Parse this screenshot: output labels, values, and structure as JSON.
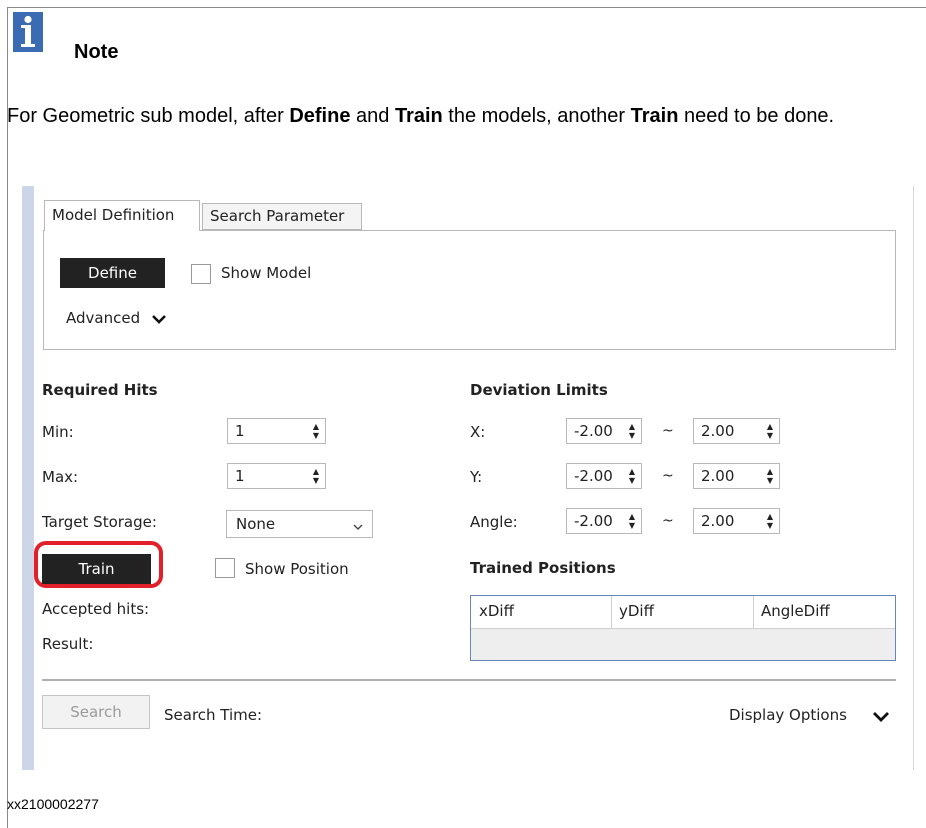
{
  "note": {
    "icon": "info-icon",
    "title": "Note",
    "text_parts": [
      {
        "text": "For Geometric sub model, after ",
        "bold": false
      },
      {
        "text": "Define",
        "bold": true
      },
      {
        "text": " and ",
        "bold": false
      },
      {
        "text": "Train",
        "bold": true
      },
      {
        "text": " the models, another ",
        "bold": false
      },
      {
        "text": "Train",
        "bold": true
      },
      {
        "text": " need to be done.",
        "bold": false
      }
    ]
  },
  "screenshot": {
    "tabs": [
      "Model Definition",
      "Search Parameter"
    ],
    "define_label": "Define",
    "show_model_label": "Show Model",
    "advanced_label": "Advanced",
    "required_hits": {
      "heading": "Required Hits",
      "min_label": "Min:",
      "min_value": "1",
      "max_label": "Max:",
      "max_value": "1",
      "target_label": "Target Storage:",
      "target_value": "None"
    },
    "deviation": {
      "heading": "Deviation Limits",
      "x_label": "X:",
      "x_min": "-2.00",
      "x_max": "2.00",
      "y_label": "Y:",
      "y_min": "-2.00",
      "y_max": "2.00",
      "angle_label": "Angle:",
      "angle_min": "-2.00",
      "angle_max": "2.00",
      "separator": "~"
    },
    "train_label": "Train",
    "show_position_label": "Show Position",
    "accepted_hits_label": "Accepted hits:",
    "result_label": "Result:",
    "trained_positions": {
      "heading": "Trained Positions",
      "columns": [
        "xDiff",
        "yDiff",
        "AngleDiff"
      ]
    },
    "search_label": "Search",
    "search_time_label": "Search Time:",
    "display_options_label": "Display Options",
    "highlight_color": "#e2202a"
  },
  "caption": "xx2100002277"
}
